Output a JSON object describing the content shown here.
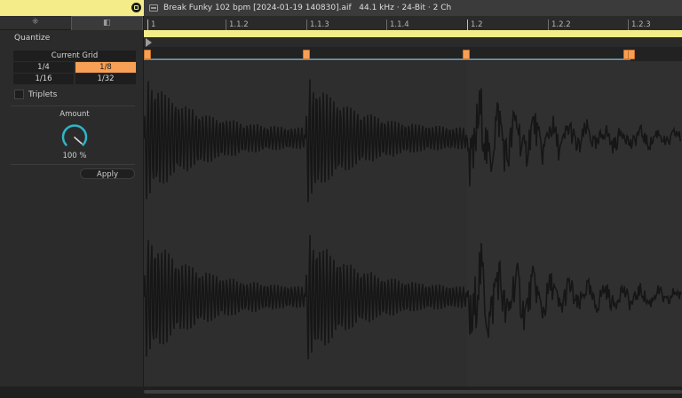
{
  "title_bar": {
    "clip_name": "Break Funky 102 bpm [2024-01-19 140830].aif",
    "sample_rate": "44.1 kHz",
    "bit_depth": "24-Bit",
    "channels": "2 Ch"
  },
  "quantize": {
    "label": "Quantize",
    "grid_header": "Current Grid",
    "grid_options": [
      "1/4",
      "1/8",
      "1/16",
      "1/32"
    ],
    "selected": "1/8",
    "triplets_label": "Triplets",
    "triplets_checked": false,
    "amount_label": "Amount",
    "amount_value": "100 %",
    "apply_label": "Apply"
  },
  "ruler": {
    "labels": [
      "1",
      "1.1.2",
      "1.1.3",
      "1.1.4",
      "1.2",
      "1.2.2",
      "1.2.3"
    ]
  },
  "colors": {
    "accent_yellow": "#f3ec89",
    "warp_marker": "#f7a055",
    "knob": "#2fb5c8",
    "waveform": "#161616"
  },
  "icons": {
    "tab_1": "sample-waveform-icon",
    "tab_2": "envelope-icon",
    "save": "save-icon",
    "clip": "clip-icon"
  }
}
